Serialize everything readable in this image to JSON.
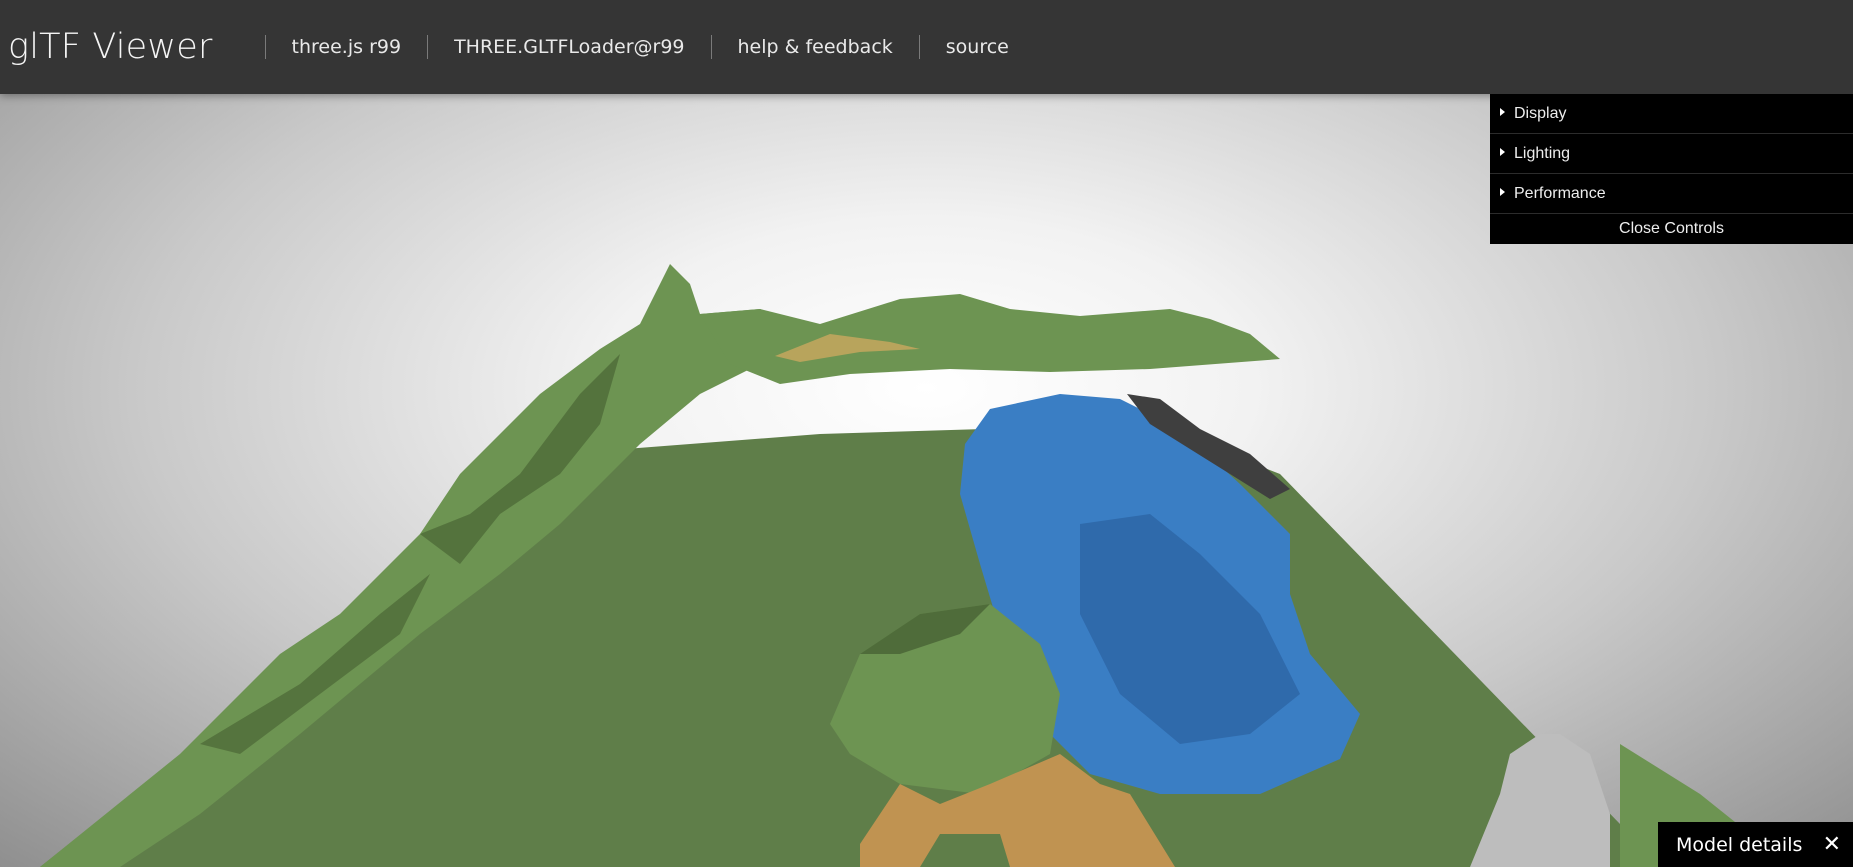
{
  "header": {
    "title": "glTF Viewer",
    "nav": [
      {
        "label": "three.js r99"
      },
      {
        "label": "THREE.GLTFLoader@r99"
      },
      {
        "label": "help & feedback"
      },
      {
        "label": "source"
      }
    ]
  },
  "controls": {
    "folders": [
      {
        "label": "Display"
      },
      {
        "label": "Lighting"
      },
      {
        "label": "Performance"
      }
    ],
    "close_label": "Close Controls"
  },
  "model_details": {
    "label": "Model details",
    "close_icon": "✕"
  },
  "colors": {
    "header_bg": "#353535",
    "terrain_grass": "#5f7e49",
    "terrain_hills": "#6d9452",
    "water": "#3a7ec4",
    "sand": "#c09351",
    "rock": "#3f3f3f",
    "snow": "#bdbdbd"
  }
}
